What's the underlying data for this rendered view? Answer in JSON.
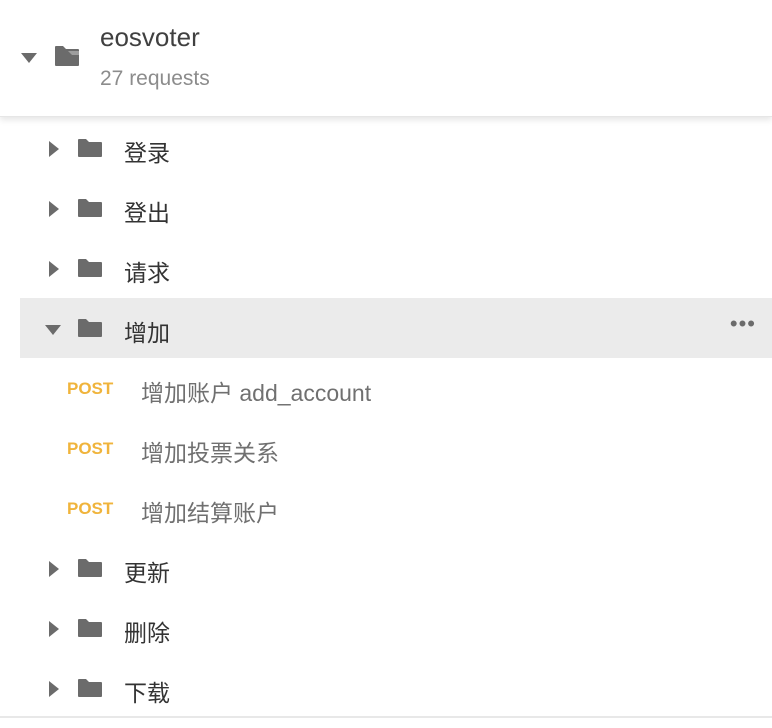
{
  "collection": {
    "name": "eosvoter",
    "request_count": "27 requests"
  },
  "folders_before": [
    {
      "label": "登录"
    },
    {
      "label": "登出"
    },
    {
      "label": "请求"
    }
  ],
  "expanded_folder": {
    "label": "增加",
    "more": "•••",
    "requests": [
      {
        "method": "POST",
        "name": "增加账户 add_account"
      },
      {
        "method": "POST",
        "name": "增加投票关系"
      },
      {
        "method": "POST",
        "name": "增加结算账户"
      }
    ]
  },
  "folders_after": [
    {
      "label": "更新"
    },
    {
      "label": "删除"
    },
    {
      "label": "下载"
    }
  ],
  "colors": {
    "post_method": "#f0b43c",
    "selected_row_bg": "#ebebeb",
    "icon_gray": "#6b6b6b"
  }
}
